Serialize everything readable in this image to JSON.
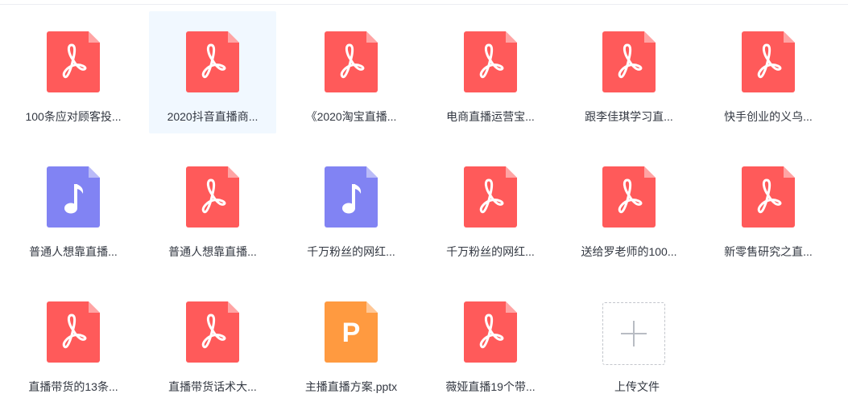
{
  "colors": {
    "pdf": "#ff5a5a",
    "audio": "#8183f3",
    "pptx": "#ff9a40",
    "hover_bg": "#f1f8ff"
  },
  "files": [
    {
      "name": "100条应对顾客投...",
      "type": "pdf",
      "icon": "pdf-icon"
    },
    {
      "name": "2020抖音直播商...",
      "type": "pdf",
      "icon": "pdf-icon"
    },
    {
      "name": "《2020淘宝直播...",
      "type": "pdf",
      "icon": "pdf-icon"
    },
    {
      "name": "电商直播运营宝...",
      "type": "pdf",
      "icon": "pdf-icon"
    },
    {
      "name": "跟李佳琪学习直...",
      "type": "pdf",
      "icon": "pdf-icon"
    },
    {
      "name": "快手创业的义乌...",
      "type": "pdf",
      "icon": "pdf-icon"
    },
    {
      "name": "普通人想靠直播...",
      "type": "audio",
      "icon": "music-note-icon"
    },
    {
      "name": "普通人想靠直播...",
      "type": "pdf",
      "icon": "pdf-icon"
    },
    {
      "name": "千万粉丝的网红...",
      "type": "audio",
      "icon": "music-note-icon"
    },
    {
      "name": "千万粉丝的网红...",
      "type": "pdf",
      "icon": "pdf-icon"
    },
    {
      "name": "送给罗老师的100...",
      "type": "pdf",
      "icon": "pdf-icon"
    },
    {
      "name": "新零售研究之直...",
      "type": "pdf",
      "icon": "pdf-icon"
    },
    {
      "name": "直播带货的13条...",
      "type": "pdf",
      "icon": "pdf-icon"
    },
    {
      "name": "直播带货话术大...",
      "type": "pdf",
      "icon": "pdf-icon"
    },
    {
      "name": "主播直播方案.pptx",
      "type": "pptx",
      "icon": "pptx-icon",
      "glyph": "P"
    },
    {
      "name": "薇娅直播19个带...",
      "type": "pdf",
      "icon": "pdf-icon"
    }
  ],
  "upload": {
    "label": "上传文件",
    "icon": "plus-icon"
  },
  "hovered_index": 1
}
